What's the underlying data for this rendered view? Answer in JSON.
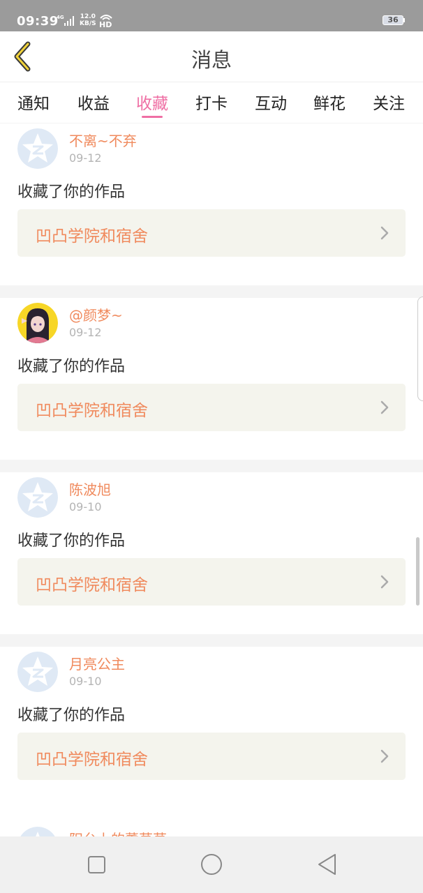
{
  "status_bar": {
    "time": "09:39",
    "network": "4G",
    "speed_value": "12.0",
    "speed_unit": "KB/S",
    "hd": "HD",
    "battery": "36"
  },
  "header": {
    "title": "消息",
    "back_icon": "chevron-left-icon"
  },
  "tabs": [
    {
      "label": "通知",
      "active": false
    },
    {
      "label": "收益",
      "active": false
    },
    {
      "label": "收藏",
      "active": true
    },
    {
      "label": "打卡",
      "active": false
    },
    {
      "label": "互动",
      "active": false
    },
    {
      "label": "鲜花",
      "active": false
    },
    {
      "label": "关注",
      "active": false
    }
  ],
  "messages": [
    {
      "username": "不离~不弃",
      "date": "09-12",
      "action": "收藏了你的作品",
      "work": "凹凸学院和宿舍",
      "avatar": "default-avatar-icon"
    },
    {
      "username": "@颜梦~",
      "date": "09-12",
      "action": "收藏了你的作品",
      "work": "凹凸学院和宿舍",
      "avatar": "anime-avatar"
    },
    {
      "username": "陈波旭",
      "date": "09-10",
      "action": "收藏了你的作品",
      "work": "凹凸学院和宿舍",
      "avatar": "default-avatar-icon"
    },
    {
      "username": "月亮公主",
      "date": "09-10",
      "action": "收藏了你的作品",
      "work": "凹凸学院和宿舍",
      "avatar": "default-avatar-icon"
    }
  ],
  "partial_message": {
    "username": "阳台上的薰草草"
  },
  "nav_bar": {
    "icons": [
      "square-icon",
      "circle-icon",
      "triangle-back-icon"
    ]
  },
  "colors": {
    "accent_pink": "#ef6fa4",
    "accent_orange": "#f08a5d",
    "status_bar": "#9b9b9b",
    "link_background": "#f4f4ed"
  }
}
